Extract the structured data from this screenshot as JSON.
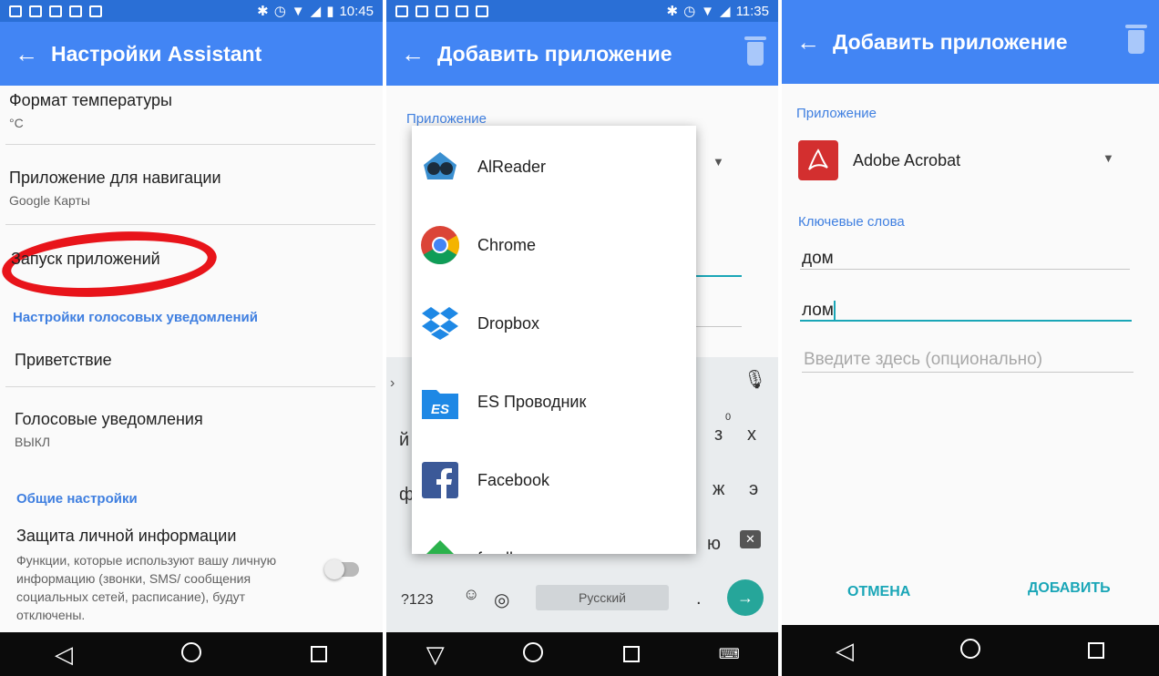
{
  "panel1": {
    "status_time": "10:45",
    "title": "Настройки Assistant",
    "items": [
      {
        "title": "Формат температуры",
        "sub": "°C"
      },
      {
        "title": "Приложение для навигации",
        "sub": "Google Карты"
      },
      {
        "title": "Запуск приложений"
      }
    ],
    "section_voice": "Настройки голосовых уведомлений",
    "greeting": "Приветствие",
    "voice_notifications": {
      "title": "Голосовые уведомления",
      "sub": "ВЫКЛ"
    },
    "section_general": "Общие настройки",
    "privacy": {
      "title": "Защита личной информации",
      "sub": "Функции, которые используют вашу личную информацию (звонки, SMS/ сообщения социальных сетей, расписание), будут отключены."
    }
  },
  "panel2": {
    "status_time": "11:35",
    "title": "Добавить приложение",
    "field_label": "Приложение",
    "apps": [
      "AlReader",
      "Chrome",
      "Dropbox",
      "ES Проводник",
      "Facebook",
      "feedly"
    ],
    "keyboard": {
      "mode_key": "?123",
      "emoji_key": "☺",
      "space_label": "Русский",
      "period_key": ".",
      "letters": [
        "й",
        "ф",
        "з",
        "х",
        "ж",
        "э",
        "ю"
      ],
      "hint_zero": "0"
    }
  },
  "panel3": {
    "title": "Добавить приложение",
    "app_label": "Приложение",
    "app_value": "Adobe Acrobat",
    "keywords_label": "Ключевые слова",
    "keyword1": "дом",
    "keyword2": "лом",
    "placeholder": "Введите здесь (опционально)",
    "cancel": "ОТМЕНА",
    "add": "ДОБАВИТЬ"
  },
  "colors": {
    "status": "#2a6fd6",
    "appbar": "#4285f4",
    "accent": "#1aa6b7",
    "highlight": "#e8141a"
  }
}
